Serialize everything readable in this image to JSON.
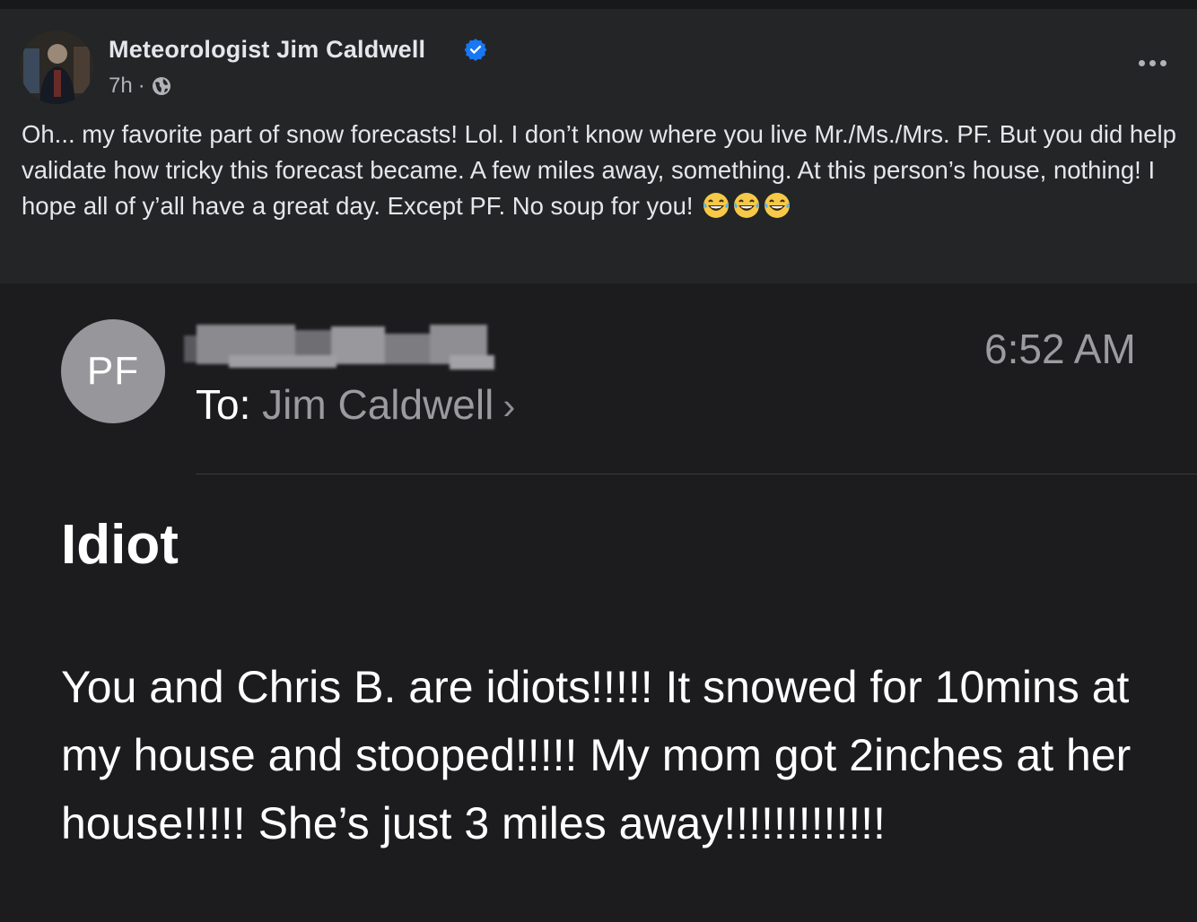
{
  "post": {
    "author": "Meteorologist Jim Caldwell",
    "time": "7h",
    "separator": "·",
    "text": "Oh... my favorite part of snow forecasts! Lol. I don’t know where you live Mr./Ms./Mrs. PF. But you did help validate how tricky this forecast became. A few miles away, something. At this person’s house, nothing! I hope all of y’all have a great day. Except PF. No soup for you!",
    "icons": {
      "verified": "verified-badge-icon",
      "globe": "globe-icon",
      "more": "more-options-icon",
      "emoji": "laughing-tears-emoji"
    },
    "colors": {
      "verified": "#1877f2",
      "background": "#242526"
    }
  },
  "email": {
    "avatar_initials": "PF",
    "to_label": "To:",
    "to_name": "Jim Caldwell",
    "chevron": "›",
    "time": "6:52 AM",
    "subject": "Idiot",
    "body": "You and Chris B. are idiots!!!!! It snowed for 10mins at my house and stooped!!!!! My mom got 2inches at her house!!!!! She’s just 3 miles away!!!!!!!!!!!!!",
    "colors": {
      "background": "#1c1c1e",
      "avatar": "#97969b"
    }
  }
}
